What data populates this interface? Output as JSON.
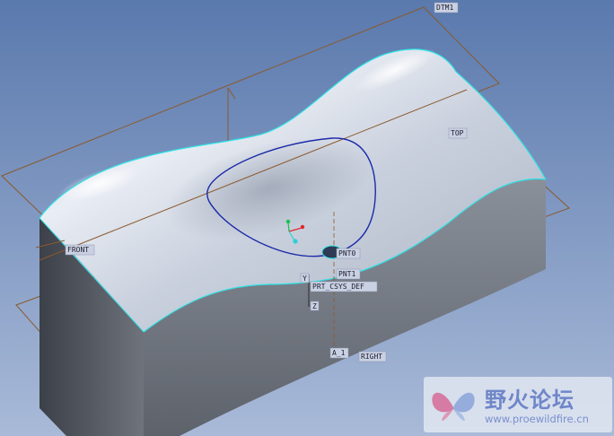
{
  "viewport": {
    "datum_planes": {
      "dtm1": "DTM1",
      "top": "TOP",
      "front": "FRONT",
      "right": "RIGHT"
    },
    "datum_points": {
      "pnt0": "PNT0",
      "pnt1": "PNT1"
    },
    "csys_label": "PRT_CSYS_DEF",
    "csys_axis_labels": {
      "y": "Y",
      "z": "Z"
    },
    "axis_label": "A_1"
  },
  "watermark": {
    "title": "野火论坛",
    "url": "www.proewildfire.cn"
  },
  "colors": {
    "background_top": "#5a79ad",
    "background_bottom": "#a9bad8",
    "datum_plane": "#8a5a2e",
    "surface_edge": "#2fe3e6",
    "sketch_curve": "#1b2aa8",
    "solid_top": "#dfe4ee",
    "solid_side": "#5a5f68"
  }
}
